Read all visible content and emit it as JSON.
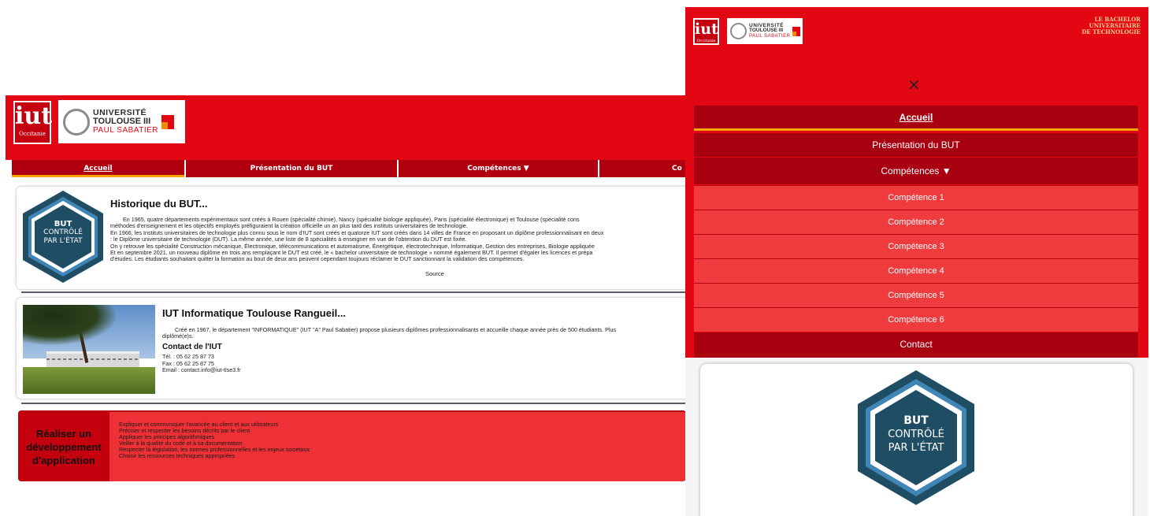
{
  "brand": {
    "iut_logo_text": "iut",
    "iut_logo_sub": "Occitanie",
    "ut3_line1": "UNIVERSITÉ",
    "ut3_line2": "TOULOUSE III",
    "ut3_line3": "PAUL SABATIER",
    "bachelor_line1": "LE BACHELOR",
    "bachelor_line2": "UNIVERSITAIRE",
    "bachelor_line3": "DE TECHNOLOGIE",
    "colors": {
      "primary_red": "#e30613",
      "dark_red": "#b00010",
      "accent_orange": "#f5a300",
      "badge_blue": "#1e4d64"
    }
  },
  "desktop": {
    "nav": [
      {
        "label": "Accueil",
        "active": true
      },
      {
        "label": "Présentation du BUT",
        "active": false
      },
      {
        "label": "Compétences ▼",
        "active": false
      },
      {
        "label": "Co",
        "active": false
      }
    ],
    "badge": {
      "line1": "BUT",
      "line2": "CONTRÔLÉ",
      "line3": "PAR L'ÉTAT"
    },
    "history": {
      "title": "Historique du BUT...",
      "p1": "En 1965, quatre départements expérimentaux sont créés à Rouen (spécialité chimie), Nancy (spécialité biologie appliquée), Paris (spécialité électronique) et Toulouse (spécialité cons",
      "p1b": "méthodes d'enseignement et les objectifs employés préfiguraient la création officielle un an plus tard des instituts universitaires de technologie.",
      "p2": "En 1966, les Instituts universitaires de technologie plus connu sous le nom d'IUT sont créés et quatorze IUT sont créés dans 14 villes de France en proposant un diplôme professionnalisant en deux",
      "p2b": ": le Diplôme universitaire de technologie (DUT). La même année, une liste de 8 spécialités à enseigner en vue de l'obtention du DUT est fixée.",
      "p3": "On y retrouve les spécialité Construction mécanique, Électronique, télécommunications et automatisme, Énergétique, électrotechnique, Informatique, Gestion des entreprises, Biologie appliquée",
      "p4": "Et en septembre 2021, un nouveau diplôme en trois ans remplaçant le DUT est créé, le « bachelor universitaire de technologie » nommé également BUT. Il permet d'égaler les licences et prépa",
      "p4b": "d'études. Les étudiants souhaitant quitter la formation au bout de deux ans peuvent cependant toujours réclamer le DUT sanctionnant la validation des compétences.",
      "source": "Source"
    },
    "iut": {
      "title": "IUT Informatique Toulouse Rangueil...",
      "text": "Créé en 1967, le département \"INFORMATIQUE\" (IUT \"A\" Paul Sabatier) propose plusieurs diplômes professionnalisants et accueille chaque année près de 500 étudiants. Plus",
      "text2": "diplômé(e)s.",
      "contact_title": "Contact de l'IUT",
      "tel": "Tél. : 05 62 25 87 73",
      "fax": "Fax : 05 62 25 87 75",
      "email": "Email : contact.info@iut-tlse3.fr"
    },
    "competence": {
      "label": "Réaliser un développement d'application",
      "items": [
        "Expliquer et communiquer l'avancée au client et aux utilisateurs",
        "Préciser et respecter les besoins décrits par le client",
        "Appliquer les principes algorithmiques",
        "Veiller à la qualité du code et à sa documentation",
        "Respecter la législation, les normes professionnelles et les enjeux sociétaux",
        "Choisir les ressources techniques appropriées"
      ]
    }
  },
  "mobile": {
    "close_symbol": "×",
    "menu": {
      "home": "Accueil",
      "presentation": "Présentation du BUT",
      "competences": "Compétences ▼",
      "subitems": [
        "Compétence 1",
        "Compétence 2",
        "Compétence 3",
        "Compétence 4",
        "Compétence 5",
        "Compétence 6"
      ],
      "contact": "Contact"
    },
    "badge": {
      "line1": "BUT",
      "line2": "CONTRÔLÉ",
      "line3": "PAR L'ÉTAT"
    }
  }
}
